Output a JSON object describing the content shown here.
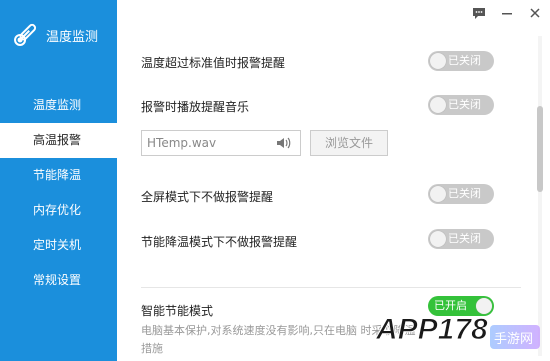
{
  "app": {
    "title": "温度监测"
  },
  "sidebar": {
    "items": [
      {
        "label": "温度监测",
        "active": false
      },
      {
        "label": "高温报警",
        "active": true
      },
      {
        "label": "节能降温",
        "active": false
      },
      {
        "label": "内存优化",
        "active": false
      },
      {
        "label": "定时关机",
        "active": false
      },
      {
        "label": "常规设置",
        "active": false
      }
    ]
  },
  "window": {
    "icons": [
      "feedback-icon",
      "minimize-icon",
      "close-icon"
    ]
  },
  "settings": {
    "over_temp_alert": {
      "label": "温度超过标准值时报警提醒",
      "state": "已关闭"
    },
    "alarm_sound": {
      "label": "报警时播放提醒音乐",
      "state": "已关闭"
    },
    "sound_file": {
      "value": "HTemp.wav"
    },
    "browse_button": {
      "label": "浏览文件"
    },
    "fullscreen_no_alert": {
      "label": "全屏模式下不做报警提醒",
      "state": "已关闭"
    },
    "eco_no_alert": {
      "label": "节能降温模式下不做报警提醒",
      "state": "已关闭"
    }
  },
  "smart_mode": {
    "title": "智能节能模式",
    "state": "已开启",
    "description": "电脑基本保护,对系统速度没有影响,只在电脑 时采取降温措施"
  },
  "watermark": {
    "text": "APP178",
    "sub": "手游网"
  },
  "colors": {
    "sidebar": "#1b8fdc",
    "toggle_off": "#c9c9c9",
    "toggle_on": "#34c23a"
  }
}
